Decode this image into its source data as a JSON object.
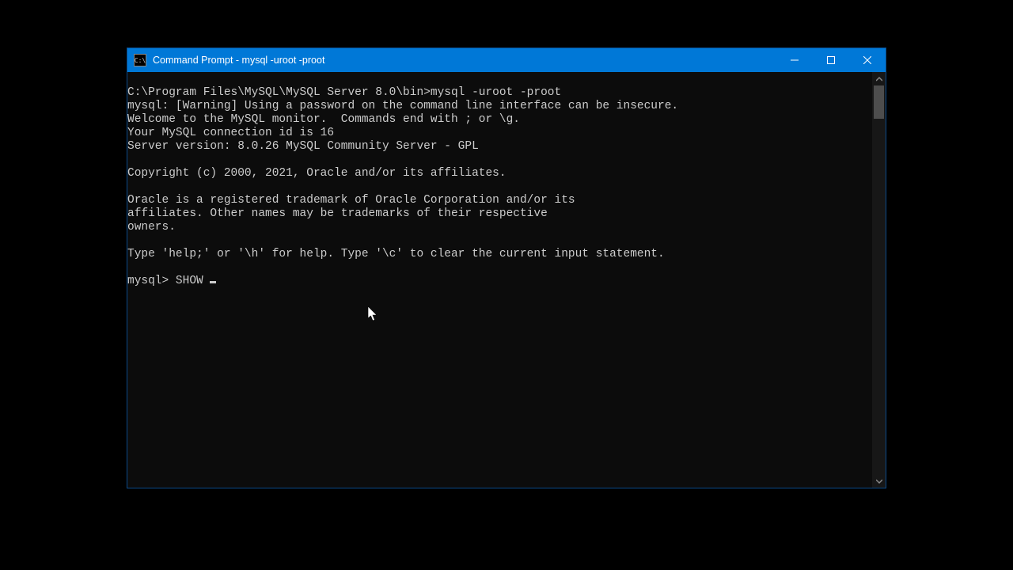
{
  "window": {
    "icon_text": "C:\\",
    "title": "Command Prompt - mysql  -uroot -proot"
  },
  "terminal": {
    "lines": [
      "C:\\Program Files\\MySQL\\MySQL Server 8.0\\bin>mysql -uroot -proot",
      "mysql: [Warning] Using a password on the command line interface can be insecure.",
      "Welcome to the MySQL monitor.  Commands end with ; or \\g.",
      "Your MySQL connection id is 16",
      "Server version: 8.0.26 MySQL Community Server - GPL",
      "",
      "Copyright (c) 2000, 2021, Oracle and/or its affiliates.",
      "",
      "Oracle is a registered trademark of Oracle Corporation and/or its",
      "affiliates. Other names may be trademarks of their respective",
      "owners.",
      "",
      "Type 'help;' or '\\h' for help. Type '\\c' to clear the current input statement.",
      ""
    ],
    "prompt": "mysql> ",
    "input": "SHOW "
  }
}
